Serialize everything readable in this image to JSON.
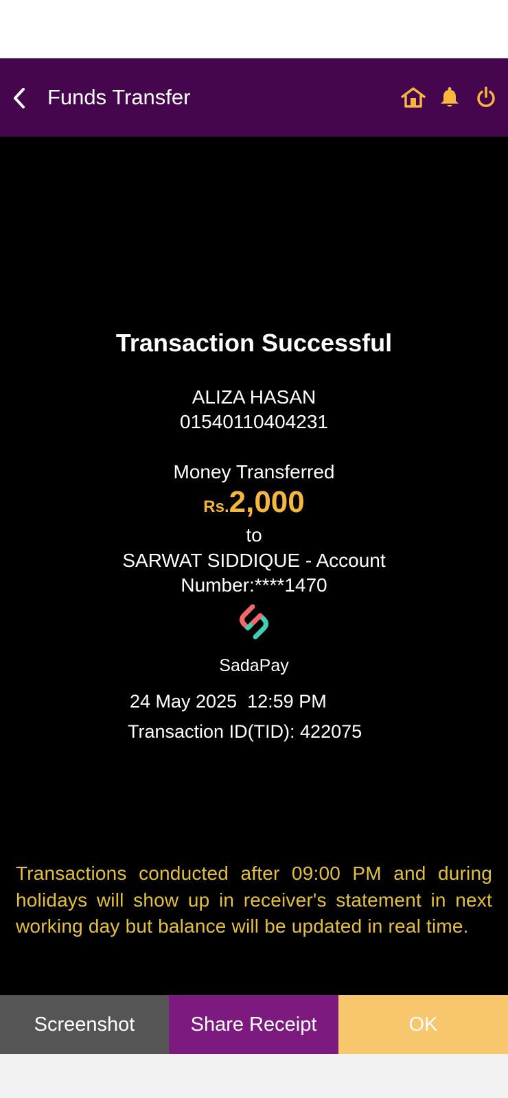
{
  "header": {
    "title": "Funds Transfer",
    "icons": [
      "chevron-left-icon",
      "home-icon",
      "bell-icon",
      "power-icon"
    ],
    "accent_color": "#f6b73c",
    "background_color": "#45064d"
  },
  "receipt": {
    "title": "Transaction Successful",
    "sender_name": "ALIZA HASAN",
    "sender_account": "01540110404231",
    "money_label": "Money Transferred",
    "currency": "Rs.",
    "amount": "2,000",
    "to_label": "to",
    "receiver": "SARWAT SIDDIQUE  - Account Number:****1470",
    "bank_name": "SadaPay",
    "date": "24 May 2025",
    "time": "12:59 PM",
    "tid": "Transaction ID(TID): 422075"
  },
  "notice": "Transactions conducted after 09:00 PM and during holidays will show up in receiver's statement in next working day but balance will be updated in real time.",
  "actions": {
    "screenshot": "Screenshot",
    "share": "Share Receipt",
    "ok": "OK"
  }
}
